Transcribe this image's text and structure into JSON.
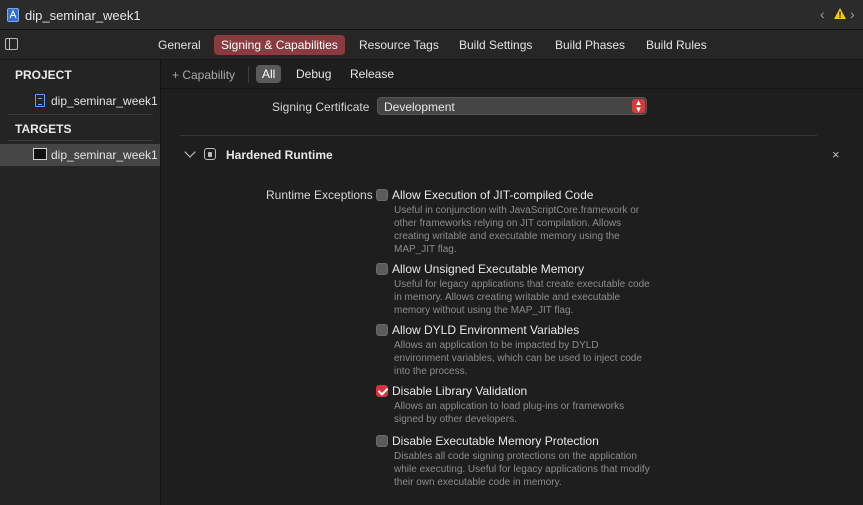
{
  "titlebar": {
    "title": "dip_seminar_week1",
    "nav_back": "‹",
    "nav_forward": "›"
  },
  "tabs": [
    {
      "label": "General",
      "active": false
    },
    {
      "label": "Signing & Capabilities",
      "active": true
    },
    {
      "label": "Resource Tags",
      "active": false
    },
    {
      "label": "Build Settings",
      "active": false
    },
    {
      "label": "Build Phases",
      "active": false
    },
    {
      "label": "Build Rules",
      "active": false
    }
  ],
  "sidebar": {
    "project_header": "PROJECT",
    "project_item": "dip_seminar_week1",
    "targets_header": "TARGETS",
    "target_item": "dip_seminar_week1"
  },
  "config_bar": {
    "capability_label": "+ Capability",
    "segments": [
      {
        "label": "All",
        "active": true
      },
      {
        "label": "Debug",
        "active": false
      },
      {
        "label": "Release",
        "active": false
      }
    ]
  },
  "signing": {
    "label": "Signing Certificate",
    "value": "Development"
  },
  "hardened_runtime": {
    "title": "Hardened Runtime",
    "close_symbol": "×",
    "exceptions_label": "Runtime Exceptions",
    "exceptions": [
      {
        "title": "Allow Execution of JIT-compiled Code",
        "description": "Useful in conjunction with JavaScriptCore.framework or other frameworks relying on JIT compilation. Allows creating writable and executable memory using the MAP_JIT flag.",
        "checked": false
      },
      {
        "title": "Allow Unsigned Executable Memory",
        "description": "Useful for legacy applications that create executable code in memory. Allows creating writable and executable memory without using the MAP_JIT flag.",
        "checked": false
      },
      {
        "title": "Allow DYLD Environment Variables",
        "description": "Allows an application to be impacted by DYLD environment variables, which can be used to inject code into the process.",
        "checked": false
      },
      {
        "title": "Disable Library Validation",
        "description": "Allows an application to load plug-ins or frameworks signed by other developers.",
        "checked": true
      },
      {
        "title": "Disable Executable Memory Protection",
        "description": "Disables all code signing protections on the application while executing. Useful for legacy applications that modify their own executable code in memory.",
        "checked": false
      }
    ]
  },
  "colors": {
    "accent": "#8a3b3f",
    "checkbox_on": "#d8333a",
    "warning": "#f5c518"
  }
}
